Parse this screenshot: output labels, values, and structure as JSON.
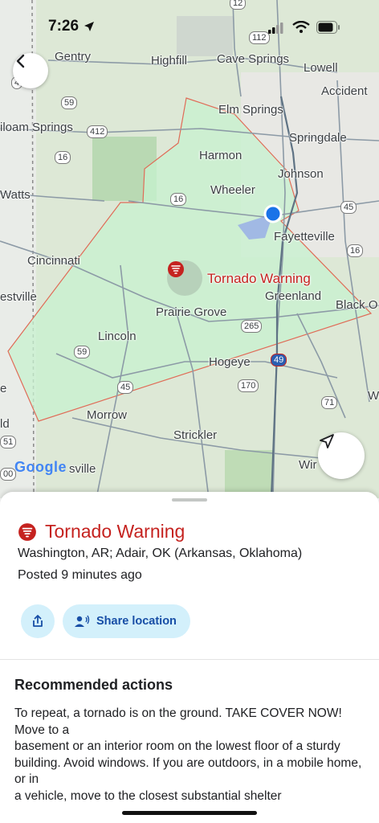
{
  "status_bar": {
    "time": "7:26"
  },
  "map": {
    "places": {
      "gentry": "Gentry",
      "highfill": "Highfill",
      "cave_springs": "Cave Springs",
      "lowell": "Lowell",
      "accident": "Accident",
      "elm_springs": "Elm Springs",
      "siloam_springs": "iloam Springs",
      "springdale": "Springdale",
      "harmon": "Harmon",
      "johnson": "Johnson",
      "watts": "Watts",
      "wheeler": "Wheeler",
      "fayetteville": "Fayetteville",
      "cincinnati": "Cincinnati",
      "westville": "estville",
      "prairie_grove": "Prairie Grove",
      "greenland": "Greenland",
      "black_oak": "Black O",
      "lincoln": "Lincoln",
      "hogeye": "Hogeye",
      "morrow": "Morrow",
      "strickler": "Strickler",
      "winslow": "Wir",
      "baron": "sville",
      "e_edge": "e",
      "ld_edge": "ld",
      "w_edge": "W"
    },
    "shields": {
      "r12": "12",
      "r112": "112",
      "r59a": "59",
      "r412": "412",
      "r16a": "16",
      "r16b": "16",
      "r16c": "16",
      "r45a": "45",
      "r45b": "45",
      "r59b": "59",
      "r265": "265",
      "r49": "49",
      "r170": "170",
      "r71": "71",
      "r51": "51",
      "r00": "00",
      "r4": "4"
    },
    "warning_label": "Tornado Warning",
    "attribution": "Google",
    "colors": {
      "warning_fill": "#c7f2cf",
      "warning_border": "#e06b57",
      "accent_red": "#c5221f",
      "location_blue": "#1a73e8"
    }
  },
  "sheet": {
    "title": "Tornado Warning",
    "region": "Washington, AR; Adair, OK (Arkansas, Oklahoma)",
    "posted": "Posted 9 minutes ago",
    "share_location_label": "Share location",
    "recommended_title": "Recommended actions",
    "recommended_text": "To repeat, a tornado is on the ground. TAKE COVER NOW! Move to a\nbasement or an interior room on the lowest floor of a sturdy\nbuilding. Avoid windows. If you are outdoors, in a mobile home, or in\na vehicle, move to the closest substantial shelter"
  }
}
